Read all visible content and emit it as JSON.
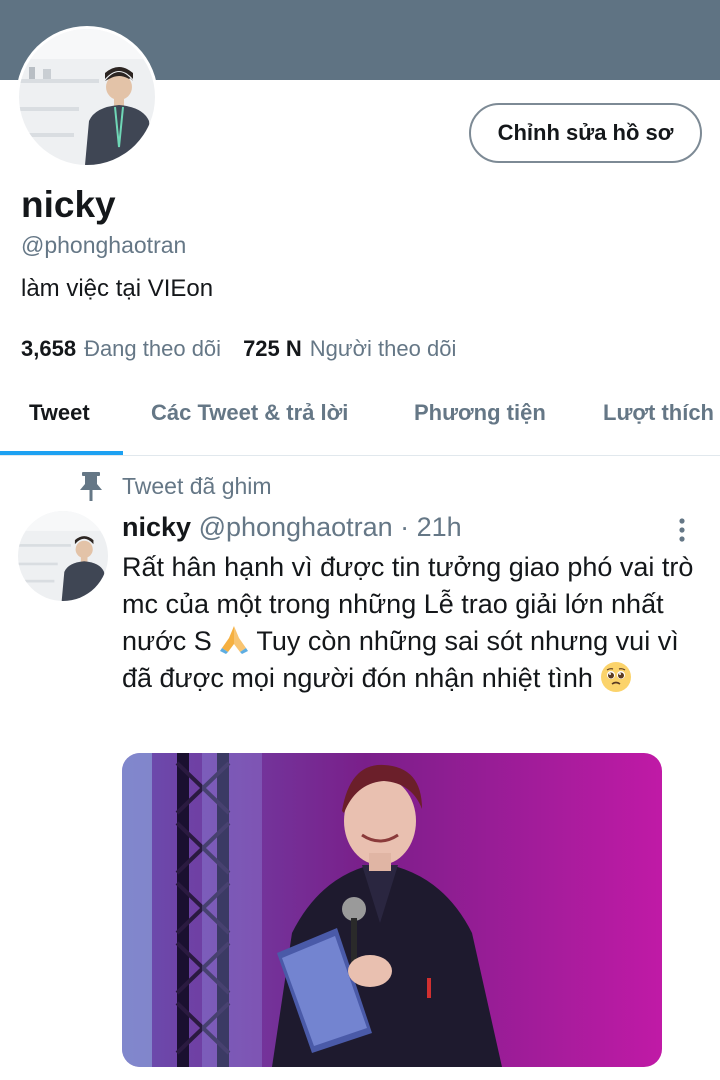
{
  "profile": {
    "banner_color": "#5f7383",
    "edit_button_label": "Chỉnh sửa hồ sơ",
    "display_name": "nicky",
    "handle": "@phonghaotran",
    "bio": "làm việc tại VIEon",
    "following_count": "3,658",
    "following_label": "Đang theo dõi",
    "followers_count": "725 N",
    "followers_label": "Người theo dõi"
  },
  "tabs": [
    {
      "label": "Tweet",
      "active": true
    },
    {
      "label": "Các Tweet & trả lời",
      "active": false
    },
    {
      "label": "Phương tiện",
      "active": false
    },
    {
      "label": "Lượt thích",
      "active": false
    }
  ],
  "pinned": {
    "label": "Tweet đã ghim",
    "icon": "pin-icon"
  },
  "tweet": {
    "author_name": "nicky",
    "author_handle": "@phonghaotran",
    "time": "· 21h",
    "text_part1": "Rất hân hạnh vì được tin tưởng giao phó vai trò mc của một trong những Lễ trao giải lớn nhất nước S ",
    "emoji1": "folded-hands-emoji",
    "text_part2": " Tuy còn những sai sót nhưng vui vì đã được mọi người đón nhận nhiệt tình ",
    "emoji2": "pleading-face-emoji"
  },
  "colors": {
    "accent": "#1da1f2",
    "secondary_text": "#657786",
    "primary_text": "#14171a"
  }
}
